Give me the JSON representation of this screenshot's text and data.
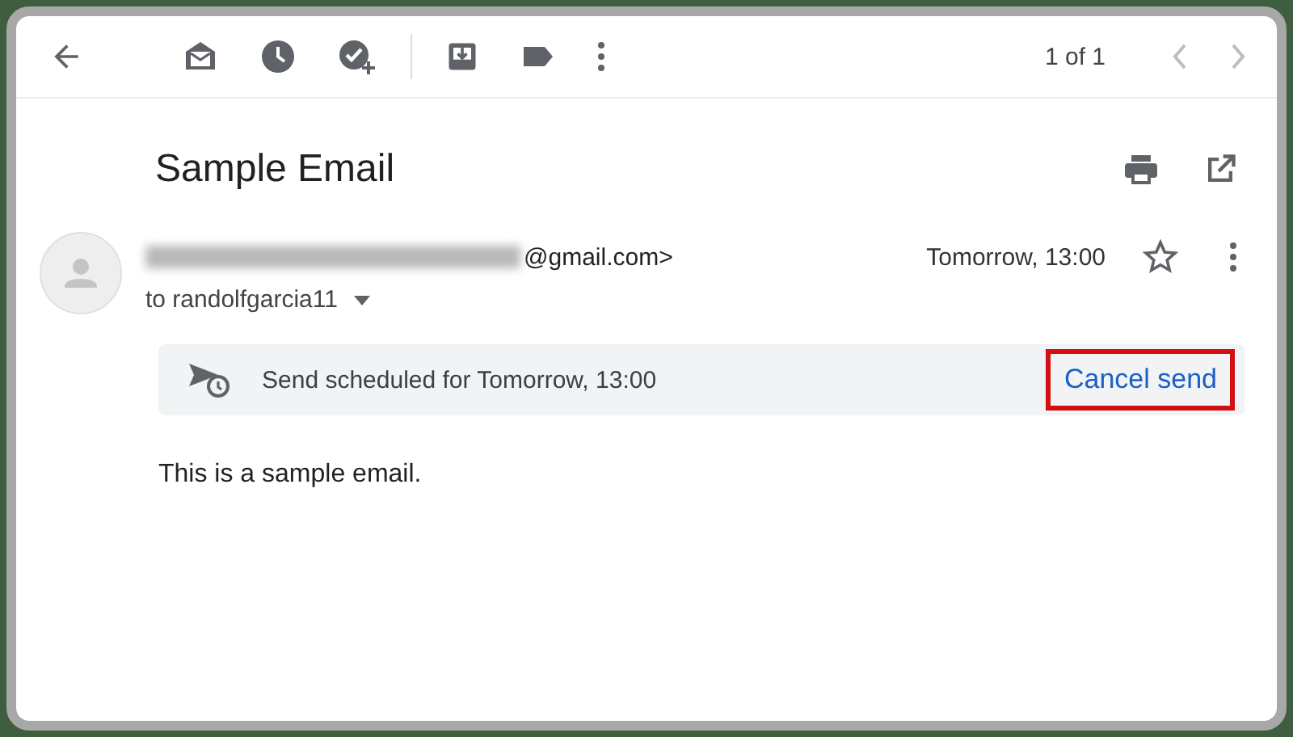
{
  "toolbar": {
    "page_count": "1 of 1"
  },
  "email": {
    "subject": "Sample Email",
    "sender_email_end": "@gmail.com>",
    "recipient": "to randolfgarcia11",
    "time": "Tomorrow, 13:00",
    "starred": false,
    "schedule_notice": "Send scheduled for Tomorrow, 13:00",
    "cancel_button": {
      "label": "Cancel send",
      "highlighted": true
    },
    "body": "This is a sample email."
  }
}
